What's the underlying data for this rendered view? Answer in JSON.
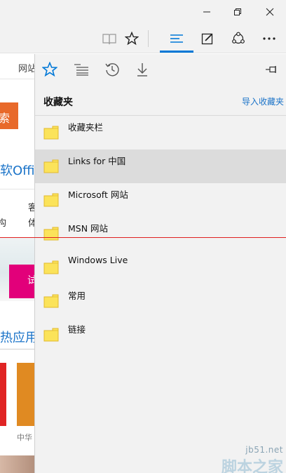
{
  "background_page": {
    "nav_text": "网站",
    "search_text": "索",
    "office_text": "软Offi",
    "col1_text": "构",
    "col2_text": "客",
    "col3_text": "体",
    "pink_text": "试",
    "hot_text": "热应用",
    "caption": "中华"
  },
  "hub": {
    "title": "收藏夹",
    "import_link": "导入收藏夹",
    "items": [
      {
        "label": "收藏夹栏",
        "selected": false
      },
      {
        "label": "Links for 中国",
        "selected": true
      },
      {
        "label": "Microsoft 网站",
        "selected": false
      },
      {
        "label": "MSN 网站",
        "selected": false
      },
      {
        "label": "Windows Live",
        "selected": false
      },
      {
        "label": "常用",
        "selected": false
      },
      {
        "label": "链接",
        "selected": false
      }
    ]
  },
  "colors": {
    "accent": "#0078d7",
    "folder": "#fbe35a",
    "link": "#1a73c8"
  },
  "watermark": {
    "url": "jb51.net",
    "name": "脚本之家"
  }
}
